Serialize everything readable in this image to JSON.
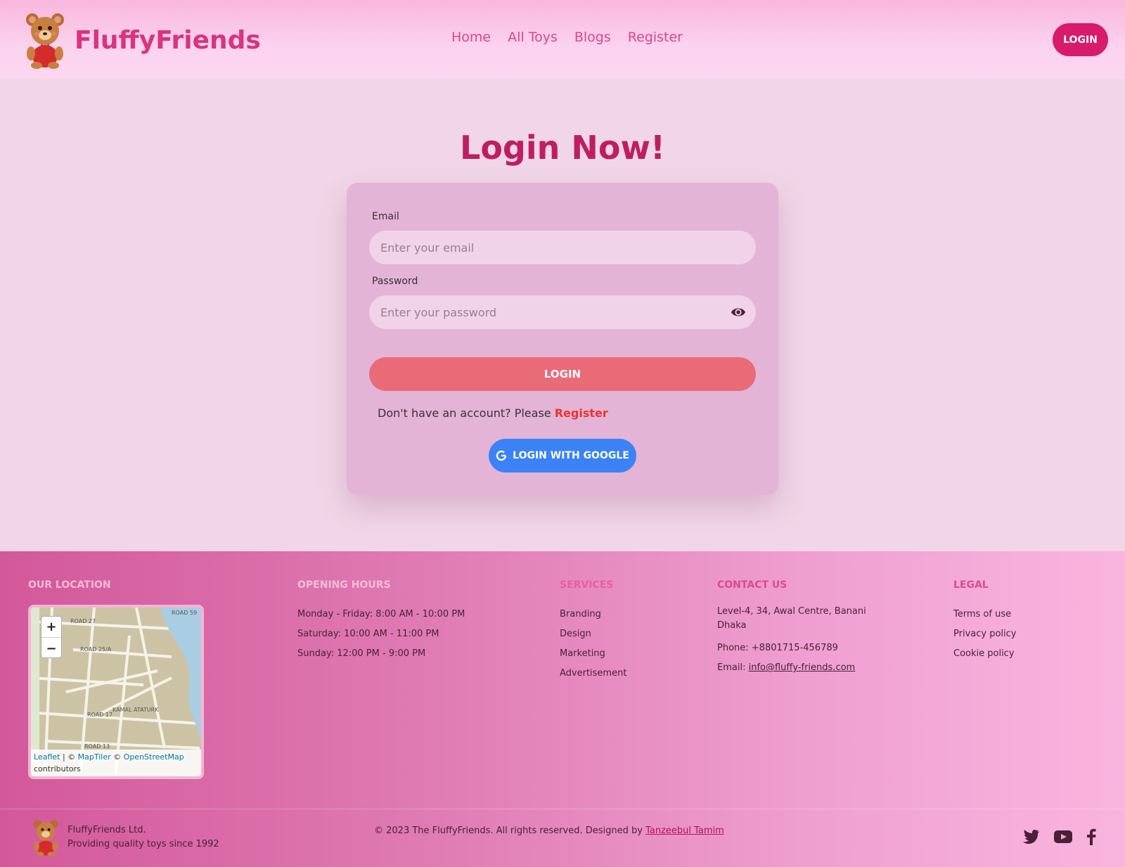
{
  "header": {
    "brand": "FluffyFriends",
    "nav": [
      "Home",
      "All Toys",
      "Blogs",
      "Register"
    ],
    "login_label": "LOGIN"
  },
  "main": {
    "title": "Login Now!",
    "email_label": "Email",
    "email_placeholder": "Enter your email",
    "password_label": "Password",
    "password_placeholder": "Enter your password",
    "login_button": "LOGIN",
    "register_prompt": "Don't have an account? Please",
    "register_link": "Register",
    "google_button": "LOGIN WITH GOOGLE"
  },
  "footer": {
    "location_heading": "OUR LOCATION",
    "map_attribution": {
      "leaflet": "Leaflet",
      "maptiler": "MapTiler",
      "osm": "OpenStreetMap",
      "contributors": "contributors"
    },
    "hours_heading": "OPENING HOURS",
    "hours": [
      "Monday - Friday: 8:00 AM - 10:00 PM",
      "Saturday: 10:00 AM - 11:00 PM",
      "Sunday: 12:00 PM - 9:00 PM"
    ],
    "services_heading": "SERVICES",
    "services": [
      "Branding",
      "Design",
      "Marketing",
      "Advertisement"
    ],
    "contact_heading": "CONTACT US",
    "contact": {
      "address_line1": "Level-4, 34, Awal Centre, Banani",
      "address_line2": "Dhaka",
      "phone": "Phone: +8801715-456789",
      "email_label": "Email:",
      "email": "info@fluffy-friends.com"
    },
    "legal_heading": "LEGAL",
    "legal": [
      "Terms of use",
      "Privacy policy",
      "Cookie policy"
    ],
    "company": "FluffyFriends Ltd.",
    "tagline": "Providing quality toys since 1992",
    "copyright": "© 2023 The FluffyFriends. All rights reserved. Designed by",
    "designer": "Tanzeebul Tamim"
  },
  "colors": {
    "brand_pink": "#d9347e",
    "accent": "#d81b6a",
    "login_button": "#e96b78",
    "google_blue": "#3b82f6"
  }
}
